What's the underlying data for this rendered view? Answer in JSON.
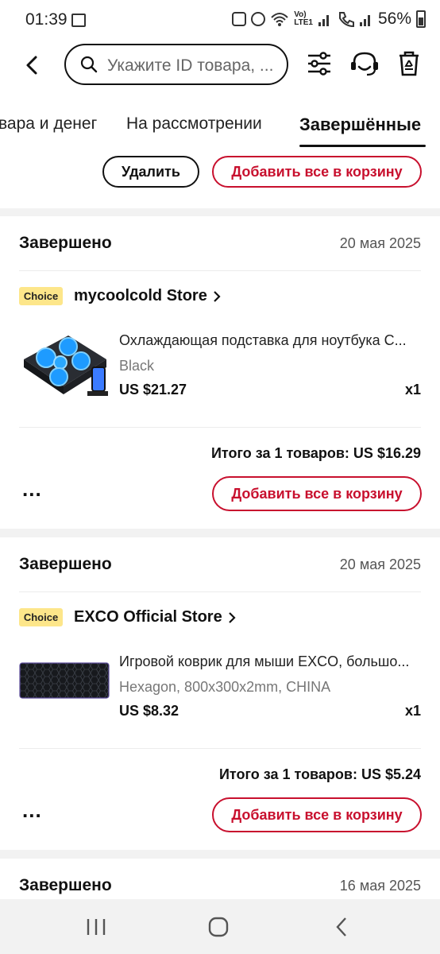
{
  "status_bar": {
    "time": "01:39",
    "battery": "56%",
    "volte": "Vo)\nLTE1"
  },
  "search": {
    "placeholder": "Укажите ID товара, ..."
  },
  "tabs": [
    {
      "label": "вара и денег"
    },
    {
      "label": "На рассмотрении"
    },
    {
      "label": "Завершённые"
    }
  ],
  "partial": {
    "delete_label": "Удалить",
    "add_all_label": "Добавить все в корзину"
  },
  "orders": [
    {
      "status": "Завершено",
      "date": "20 мая 2025",
      "badge": "Choice",
      "store": "mycoolcold Store",
      "title": "Охлаждающая подставка для ноутбука C...",
      "variant": "Black",
      "price": "US $21.27",
      "qty": "x1",
      "total": "Итого за 1 товаров: US $16.29",
      "more": "...",
      "add_all_label": "Добавить все в корзину"
    },
    {
      "status": "Завершено",
      "date": "20 мая 2025",
      "badge": "Choice",
      "store": "EXCO Official Store",
      "title": "Игровой коврик для мыши EXCO, большо...",
      "variant": "Hexagon, 800x300x2mm, CHINA",
      "price": "US $8.32",
      "qty": "x1",
      "total": "Итого за 1 товаров: US $5.24",
      "more": "...",
      "add_all_label": "Добавить все в корзину"
    },
    {
      "status": "Завершено",
      "date": "16 мая 2025"
    }
  ],
  "colors": {
    "accent": "#c8102e",
    "badge": "#fde68a"
  },
  "icons": {
    "back": "chevron-left-icon",
    "search": "search-icon",
    "filter": "filter-sliders-icon",
    "support": "headset-icon",
    "delete": "recycle-bin-icon",
    "store_arrow": "chevron-right-icon"
  }
}
